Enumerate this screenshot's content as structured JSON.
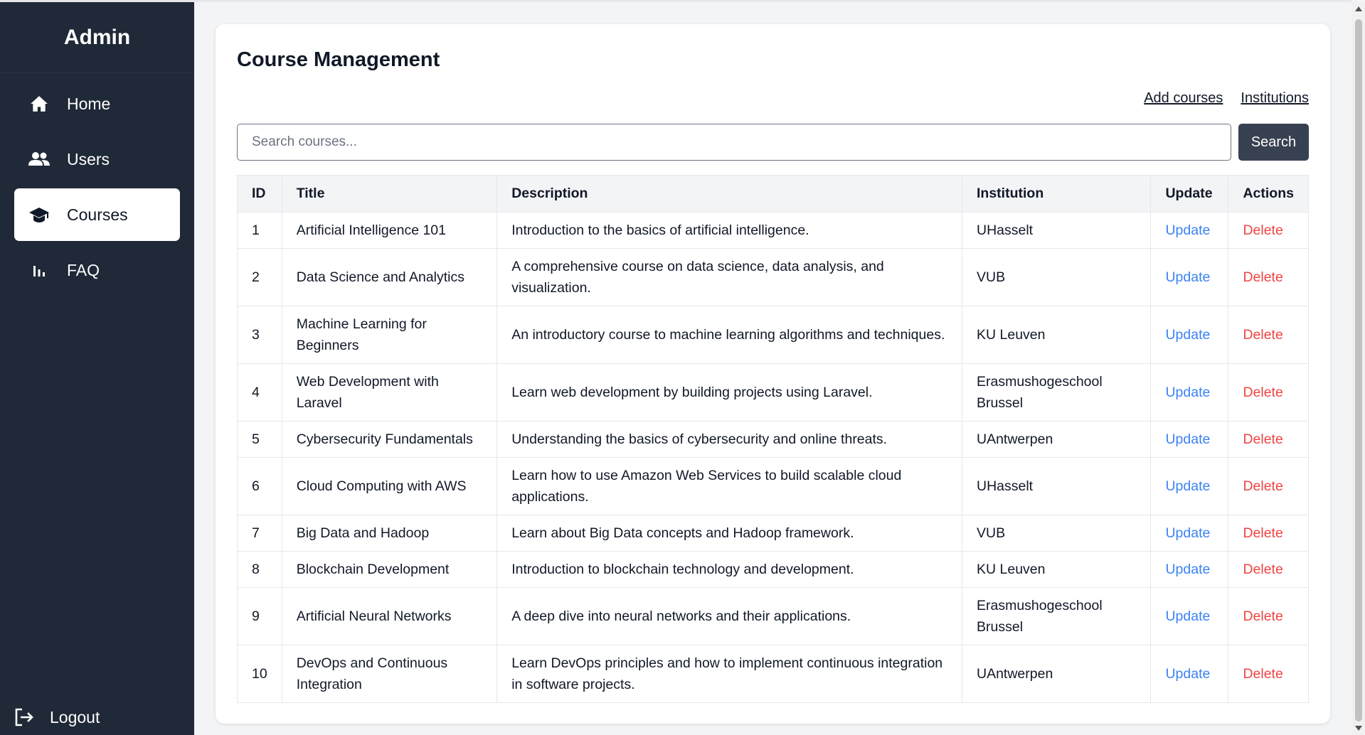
{
  "sidebar": {
    "brand": "Admin",
    "items": [
      {
        "label": "Home",
        "icon": "home-icon"
      },
      {
        "label": "Users",
        "icon": "users-icon"
      },
      {
        "label": "Courses",
        "icon": "graduation-cap-icon",
        "active": true
      },
      {
        "label": "FAQ",
        "icon": "bar-chart-icon"
      }
    ],
    "logout": "Logout"
  },
  "main": {
    "title": "Course Management",
    "links": {
      "add_courses": "Add courses",
      "institutions": "Institutions"
    },
    "search": {
      "placeholder": "Search courses...",
      "button": "Search"
    },
    "table": {
      "headers": [
        "ID",
        "Title",
        "Description",
        "Institution",
        "Update",
        "Actions"
      ],
      "rows": [
        {
          "id": "1",
          "title": "Artificial Intelligence 101",
          "description": "Introduction to the basics of artificial intelligence.",
          "institution": "UHasselt",
          "update": "Update",
          "action": "Delete"
        },
        {
          "id": "2",
          "title": "Data Science and Analytics",
          "description": "A comprehensive course on data science, data analysis, and visualization.",
          "institution": "VUB",
          "update": "Update",
          "action": "Delete"
        },
        {
          "id": "3",
          "title": "Machine Learning for Beginners",
          "description": "An introductory course to machine learning algorithms and techniques.",
          "institution": "KU Leuven",
          "update": "Update",
          "action": "Delete"
        },
        {
          "id": "4",
          "title": "Web Development with Laravel",
          "description": "Learn web development by building projects using Laravel.",
          "institution": "Erasmushogeschool Brussel",
          "update": "Update",
          "action": "Delete"
        },
        {
          "id": "5",
          "title": "Cybersecurity Fundamentals",
          "description": "Understanding the basics of cybersecurity and online threats.",
          "institution": "UAntwerpen",
          "update": "Update",
          "action": "Delete"
        },
        {
          "id": "6",
          "title": "Cloud Computing with AWS",
          "description": "Learn how to use Amazon Web Services to build scalable cloud applications.",
          "institution": "UHasselt",
          "update": "Update",
          "action": "Delete"
        },
        {
          "id": "7",
          "title": "Big Data and Hadoop",
          "description": "Learn about Big Data concepts and Hadoop framework.",
          "institution": "VUB",
          "update": "Update",
          "action": "Delete"
        },
        {
          "id": "8",
          "title": "Blockchain Development",
          "description": "Introduction to blockchain technology and development.",
          "institution": "KU Leuven",
          "update": "Update",
          "action": "Delete"
        },
        {
          "id": "9",
          "title": "Artificial Neural Networks",
          "description": "A deep dive into neural networks and their applications.",
          "institution": "Erasmushogeschool Brussel",
          "update": "Update",
          "action": "Delete"
        },
        {
          "id": "10",
          "title": "DevOps and Continuous Integration",
          "description": "Learn DevOps principles and how to implement continuous integration in software projects.",
          "institution": "UAntwerpen",
          "update": "Update",
          "action": "Delete"
        }
      ]
    }
  },
  "colors": {
    "sidebar_bg": "#1f2937",
    "update_link": "#3b82f6",
    "delete_link": "#ef4444",
    "search_button": "#374151"
  }
}
